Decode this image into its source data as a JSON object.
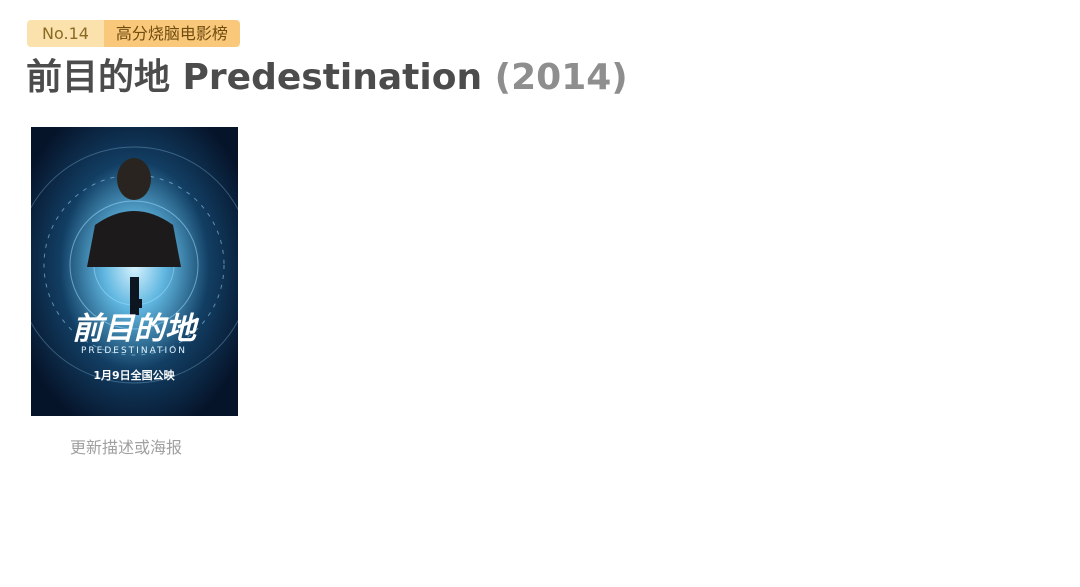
{
  "badge": {
    "rank": "No.14",
    "category": "高分烧脑电影榜"
  },
  "movie": {
    "title": "前目的地 Predestination",
    "year": "(2014)"
  },
  "poster": {
    "title_cn": "前目的地",
    "title_en": "PREDESTINATION",
    "release_line": "1月9日全国公映"
  },
  "update_link": "更新描述或海报"
}
